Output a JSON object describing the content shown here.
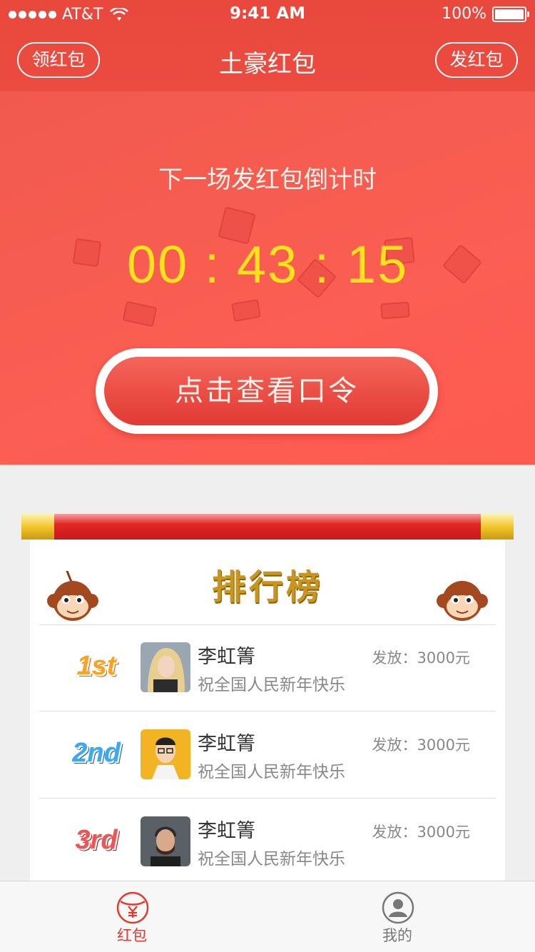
{
  "status_bar": {
    "carrier": "AT&T",
    "time": "9:41 AM",
    "battery": "100%"
  },
  "nav": {
    "left_button": "领红包",
    "title": "土豪红包",
    "right_button": "发红包"
  },
  "hero": {
    "subtitle": "下一场发红包倒计时",
    "countdown": "00 : 43 : 15",
    "cta_label": "点击查看口令"
  },
  "ranking": {
    "title": "排行榜",
    "rows": [
      {
        "rank": "1st",
        "name": "李虹箐",
        "message": "祝全国人民新年快乐",
        "amount": "发放：3000元"
      },
      {
        "rank": "2nd",
        "name": "李虹箐",
        "message": "祝全国人民新年快乐",
        "amount": "发放：3000元"
      },
      {
        "rank": "3rd",
        "name": "李虹箐",
        "message": "祝全国人民新年快乐",
        "amount": "发放：3000元"
      }
    ]
  },
  "tabbar": {
    "tab_hongbao": "红包",
    "tab_mine": "我的"
  },
  "colors": {
    "primary_red": "#e9483d",
    "countdown_yellow": "#ffe21c",
    "active_tab": "#e33a2f"
  }
}
